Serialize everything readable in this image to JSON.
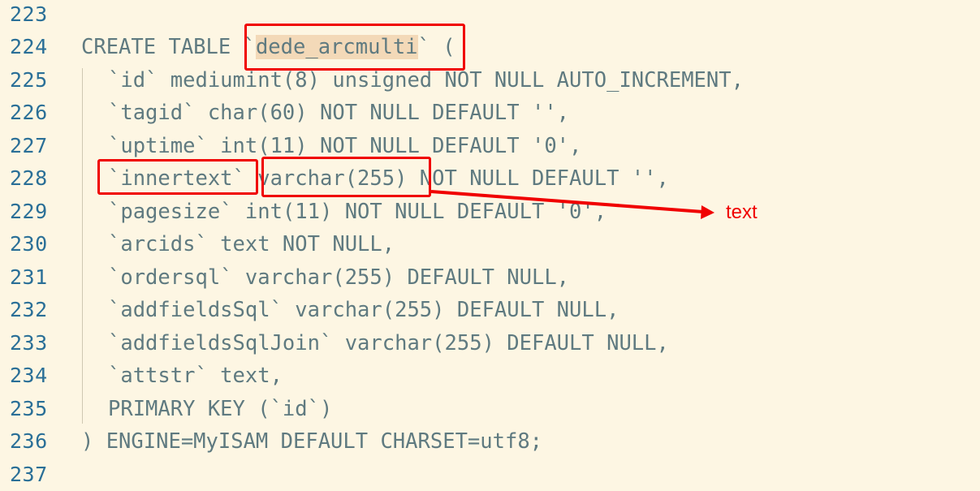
{
  "editor": {
    "lines": [
      {
        "num": "223",
        "text": ""
      },
      {
        "num": "224",
        "pre": "CREATE TABLE `",
        "table": "dede_arcmulti",
        "post": "` ("
      },
      {
        "num": "225",
        "text": "`id` mediumint(8) unsigned NOT NULL AUTO_INCREMENT,"
      },
      {
        "num": "226",
        "text": "`tagid` char(60) NOT NULL DEFAULT '',"
      },
      {
        "num": "227",
        "text": "`uptime` int(11) NOT NULL DEFAULT '0',"
      },
      {
        "num": "228",
        "text": "`innertext` varchar(255) NOT NULL DEFAULT '',"
      },
      {
        "num": "229",
        "text": "`pagesize` int(11) NOT NULL DEFAULT '0',"
      },
      {
        "num": "230",
        "text": "`arcids` text NOT NULL,"
      },
      {
        "num": "231",
        "text": "`ordersql` varchar(255) DEFAULT NULL,"
      },
      {
        "num": "232",
        "text": "`addfieldsSql` varchar(255) DEFAULT NULL,"
      },
      {
        "num": "233",
        "text": "`addfieldsSqlJoin` varchar(255) DEFAULT NULL,"
      },
      {
        "num": "234",
        "text": "`attstr` text,"
      },
      {
        "num": "235",
        "text": "PRIMARY KEY (`id`)"
      },
      {
        "num": "236",
        "text": ") ENGINE=MyISAM DEFAULT CHARSET=utf8;"
      },
      {
        "num": "237",
        "text": ""
      }
    ]
  },
  "annotation": {
    "label": "text",
    "color": "#f00000"
  }
}
